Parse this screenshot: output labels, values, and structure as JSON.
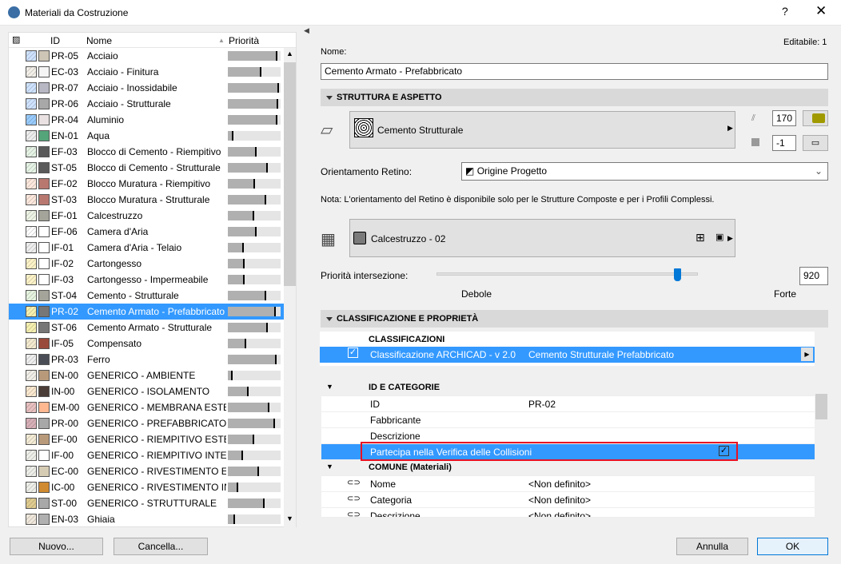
{
  "window": {
    "title": "Materiali da Costruzione",
    "help": "?",
    "close": "✕"
  },
  "list": {
    "headers": {
      "id": "ID",
      "name": "Nome",
      "priority": "Priorità"
    },
    "selected_index": 16,
    "rows": [
      {
        "id": "PR-05",
        "name": "Acciaio",
        "pat": "#cfe3ff",
        "col": "#cdc5b5",
        "p": 0.94
      },
      {
        "id": "EC-03",
        "name": "Acciaio - Finitura",
        "pat": "#f3efe9",
        "col": "#f5f5f5",
        "p": 0.63
      },
      {
        "id": "PR-07",
        "name": "Acciaio - Inossidabile",
        "pat": "#cfe3ff",
        "col": "#b8b8c4",
        "p": 0.97
      },
      {
        "id": "PR-06",
        "name": "Acciaio - Strutturale",
        "pat": "#cfe3ff",
        "col": "#a8a8a8",
        "p": 0.96
      },
      {
        "id": "PR-04",
        "name": "Aluminio",
        "pat": "#99ccff",
        "col": "#eae2e2",
        "p": 0.94
      },
      {
        "id": "EN-01",
        "name": "Aqua",
        "pat": "#eeeeee",
        "col": "#55a57a",
        "p": 0.11
      },
      {
        "id": "EF-03",
        "name": "Blocco di Cemento - Riempitivo",
        "pat": "#e6f4e6",
        "col": "#5a5a5a",
        "p": 0.54
      },
      {
        "id": "ST-05",
        "name": "Blocco di Cemento - Strutturale",
        "pat": "#e6f4e6",
        "col": "#5a5a5a",
        "p": 0.75
      },
      {
        "id": "EF-02",
        "name": "Blocco Muratura - Riempitivo",
        "pat": "#fde8dd",
        "col": "#b87870",
        "p": 0.52
      },
      {
        "id": "ST-03",
        "name": "Blocco Muratura - Strutturale",
        "pat": "#fde8dd",
        "col": "#b87870",
        "p": 0.73
      },
      {
        "id": "EF-01",
        "name": "Calcestruzzo",
        "pat": "#eef5e6",
        "col": "#a4a49a",
        "p": 0.5
      },
      {
        "id": "EF-06",
        "name": "Camera d'Aria",
        "pat": "#ffffff",
        "col": "#ffffff",
        "p": 0.55
      },
      {
        "id": "IF-01",
        "name": "Camera d'Aria - Telaio",
        "pat": "#eeeeee",
        "col": "#ffffff",
        "p": 0.3
      },
      {
        "id": "IF-02",
        "name": "Cartongesso",
        "pat": "#fdf3c8",
        "col": "#ffffff",
        "p": 0.32
      },
      {
        "id": "IF-03",
        "name": "Cartongesso - Impermeabile",
        "pat": "#fdf3c8",
        "col": "#ffffff",
        "p": 0.32
      },
      {
        "id": "ST-04",
        "name": "Cemento - Strutturale",
        "pat": "#e6f4e0",
        "col": "#a4a49a",
        "p": 0.73
      },
      {
        "id": "PR-02",
        "name": "Cemento Armato - Prefabbricato",
        "pat": "#f6f0b0",
        "col": "#777777",
        "p": 0.91
      },
      {
        "id": "ST-06",
        "name": "Cemento Armato - Strutturale",
        "pat": "#f6f0b0",
        "col": "#777777",
        "p": 0.76
      },
      {
        "id": "IF-05",
        "name": "Compensato",
        "pat": "#f3ead0",
        "col": "#9a4a3a",
        "p": 0.35
      },
      {
        "id": "PR-03",
        "name": "Ferro",
        "pat": "#eeeeee",
        "col": "#4a4d55",
        "p": 0.92
      },
      {
        "id": "EN-00",
        "name": "GENERICO - AMBIENTE",
        "pat": "#f1efe8",
        "col": "#b89a7a",
        "p": 0.09
      },
      {
        "id": "IN-00",
        "name": "GENERICO - ISOLAMENTO",
        "pat": "#fbe9d0",
        "col": "#4a3c36",
        "p": 0.4
      },
      {
        "id": "EM-00",
        "name": "GENERICO - MEMBRANA ESTERNA",
        "pat": "#e8c0c0",
        "col": "#ffb890",
        "p": 0.79
      },
      {
        "id": "PR-00",
        "name": "GENERICO - PREFABBRICATO",
        "pat": "#d8b0b8",
        "col": "#a8a8a8",
        "p": 0.89
      },
      {
        "id": "EF-00",
        "name": "GENERICO - RIEMPITIVO ESTERNO",
        "pat": "#f4ecd6",
        "col": "#b89a7a",
        "p": 0.5
      },
      {
        "id": "IF-00",
        "name": "GENERICO - RIEMPITIVO INTERNO",
        "pat": "#efefea",
        "col": "#ffffff",
        "p": 0.29
      },
      {
        "id": "EC-00",
        "name": "GENERICO - RIVESTIMENTO ESTERNO",
        "pat": "#efefea",
        "col": "#d6ccb4",
        "p": 0.59
      },
      {
        "id": "IC-00",
        "name": "GENERICO - RIVESTIMENTO INTERNO",
        "pat": "#efefea",
        "col": "#d08a30",
        "p": 0.2
      },
      {
        "id": "ST-00",
        "name": "GENERICO - STRUTTURALE",
        "pat": "#e0cc90",
        "col": "#a8a8a8",
        "p": 0.7
      },
      {
        "id": "EN-03",
        "name": "Ghiaia",
        "pat": "#f0e8dc",
        "col": "#b0b0b0",
        "p": 0.13
      }
    ]
  },
  "buttons": {
    "new": "Nuovo...",
    "delete": "Cancella...",
    "cancel": "Annulla",
    "ok": "OK"
  },
  "editable": "Editabile: 1",
  "name_label": "Nome:",
  "name_value": "Cemento Armato - Prefabbricato",
  "structure": {
    "title": "STRUTTURA E ASPETTO",
    "fill": "Cemento Strutturale",
    "pen1": "170",
    "pen2": "-1",
    "pen_color": "#a09a00",
    "orient_label": "Orientamento Retino:",
    "orient_value": "Origine Progetto",
    "note": "Nota: L'orientamento del Retino è disponibile solo per le Strutture Composte e per i Profili Complessi.",
    "surface": "Calcestruzzo - 02",
    "surface_color": "#7a7a7a",
    "priority_label": "Priorità intersezione:",
    "priority_value": "920",
    "priority_fraction": 0.92,
    "weak": "Debole",
    "strong": "Forte"
  },
  "classif": {
    "title": "CLASSIFICAZIONE E PROPRIETÀ",
    "header": "CLASSIFICAZIONI",
    "system": "Classificazione ARCHICAD - v 2.0",
    "value": "Cemento Strutturale Prefabbricato"
  },
  "props": {
    "group1": "ID E CATEGORIE",
    "rows1": [
      {
        "k": "ID",
        "v": "PR-02"
      },
      {
        "k": "Fabbricante",
        "v": ""
      },
      {
        "k": "Descrizione",
        "v": ""
      }
    ],
    "collision": "Partecipa nella Verifica delle Collisioni",
    "group2": "COMUNE (Materiali)",
    "rows2": [
      {
        "k": "Nome",
        "v": "<Non definito>"
      },
      {
        "k": "Categoria",
        "v": "<Non definito>"
      },
      {
        "k": "Descrizione",
        "v": "<Non definito>"
      }
    ]
  }
}
